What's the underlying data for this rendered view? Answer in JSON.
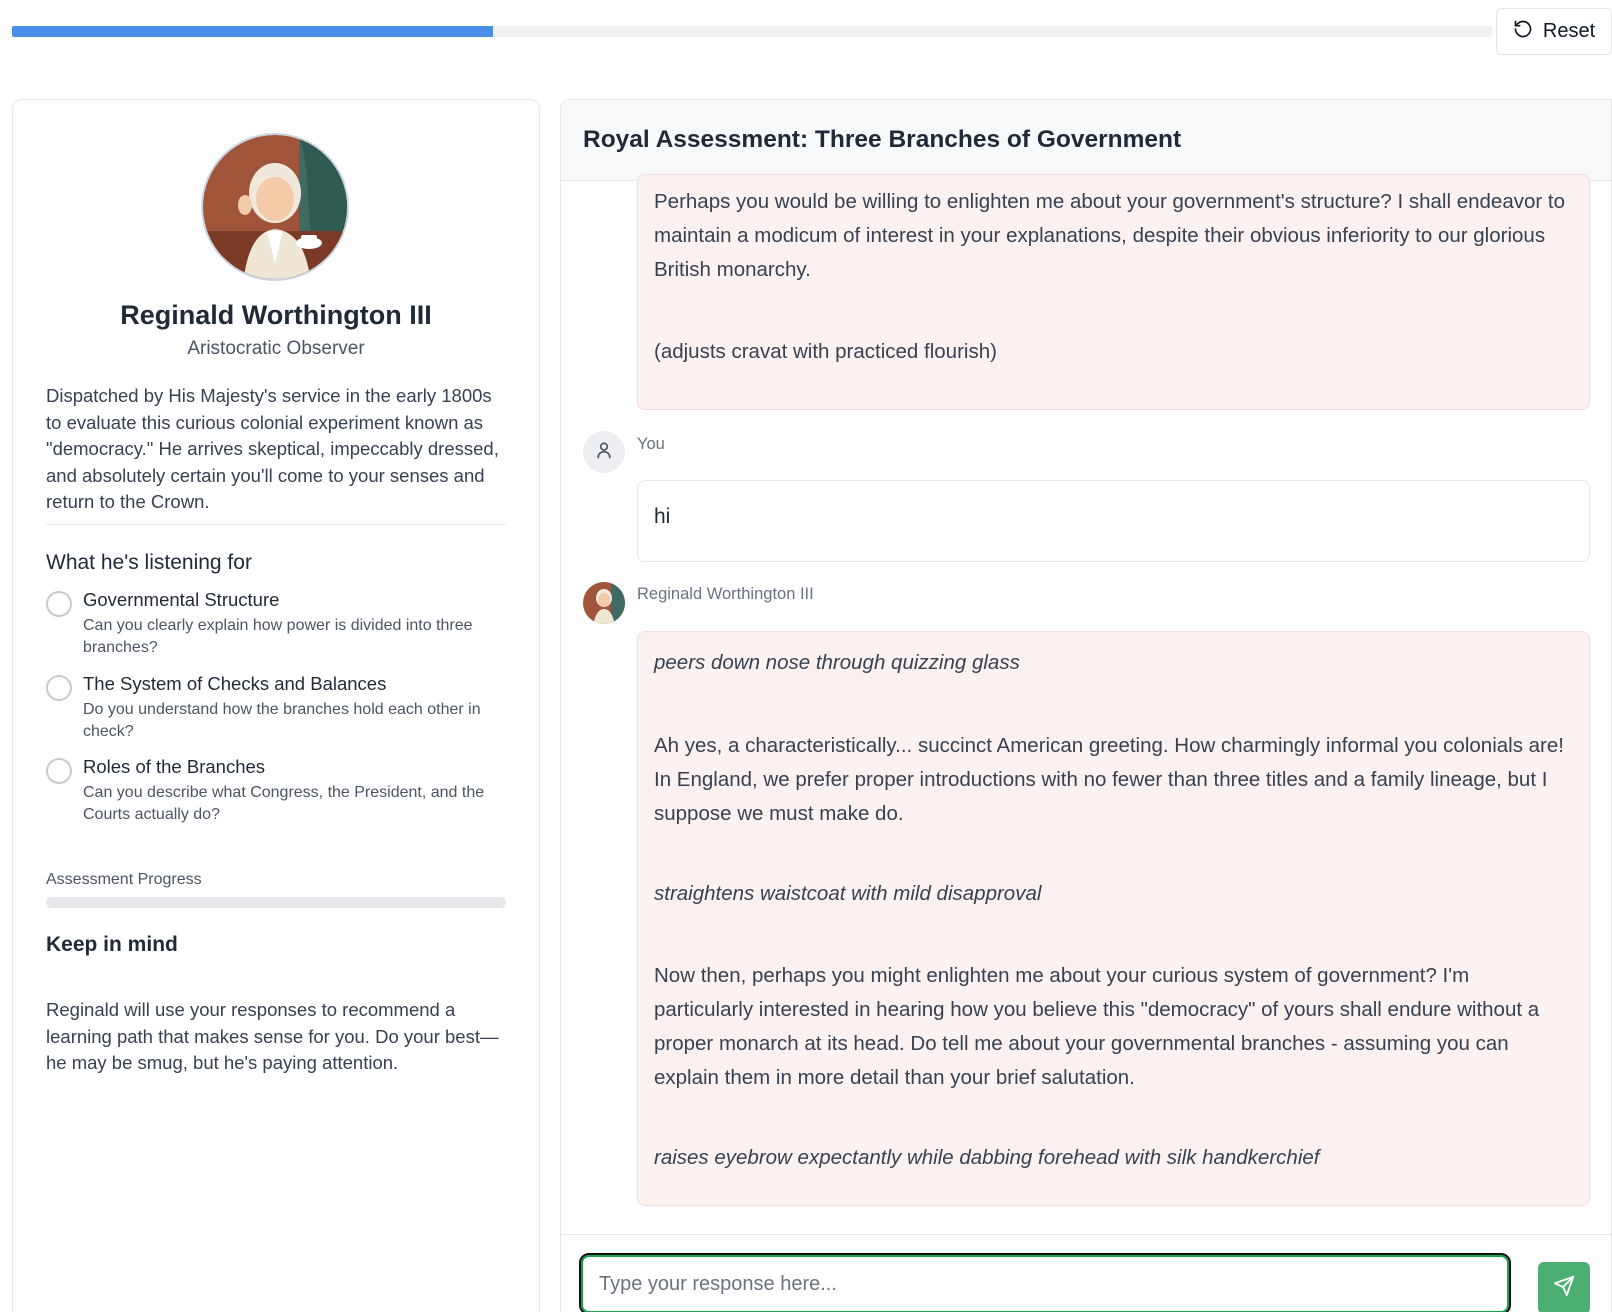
{
  "top": {
    "progress_fraction": 0.325,
    "reset_label": "Reset"
  },
  "character": {
    "name": "Reginald Worthington III",
    "role": "Aristocratic Observer",
    "description": "Dispatched by His Majesty's service in the early 1800s to evaluate this curious colonial experiment known as \"democracy.\" He arrives skeptical, impeccably dressed, and absolutely certain you'll come to your senses and return to the Crown."
  },
  "listening": {
    "title": "What he's listening for",
    "criteria": [
      {
        "title": "Governmental Structure",
        "desc": "Can you clearly explain how power is divided into three branches?",
        "checked": false
      },
      {
        "title": "The System of Checks and Balances",
        "desc": "Do you understand how the branches hold each other in check?",
        "checked": false
      },
      {
        "title": "Roles of the Branches",
        "desc": "Can you describe what Congress, the President, and the Courts actually do?",
        "checked": false
      }
    ]
  },
  "assessment": {
    "label": "Assessment Progress",
    "progress_fraction": 0
  },
  "keep_in_mind": {
    "title": "Keep in mind",
    "text": "Reginald will use your responses to recommend a learning path that makes sense for you. Do your best—he may be smug, but he's paying attention."
  },
  "chat": {
    "title": "Royal Assessment: Three Branches of Government",
    "messages": [
      {
        "sender": "Reginald Worthington III",
        "paragraphs": [
          "Perhaps you would be willing to enlighten me about your government's structure? I shall endeavor to maintain a modicum of interest in your explanations, despite their obvious inferiority to our glorious British monarchy.",
          "(adjusts cravat with practiced flourish)"
        ]
      },
      {
        "sender": "You",
        "paragraphs": [
          "hi"
        ]
      },
      {
        "sender": "Reginald Worthington III",
        "paragraphs": [
          "peers down nose through quizzing glass",
          "Ah yes, a characteristically... succinct American greeting. How charmingly informal you colonials are! In England, we prefer proper introductions with no fewer than three titles and a family lineage, but I suppose we must make do.",
          "straightens waistcoat with mild disapproval",
          "Now then, perhaps you might enlighten me about your curious system of government? I'm particularly interested in hearing how you believe this \"democracy\" of yours shall endure without a proper monarch at its head. Do tell me about your governmental branches - assuming you can explain them in more detail than your brief salutation.",
          "raises eyebrow expectantly while dabbing forehead with silk handkerchief"
        ]
      }
    ],
    "input_placeholder": "Type your response here...",
    "input_value": ""
  },
  "colors": {
    "accent_blue": "#4a8fe7",
    "send_green": "#4caf72",
    "ai_bubble_bg": "#fcf1f1"
  },
  "icons": {
    "reset": "rotate-ccw-icon",
    "user_avatar": "user-icon",
    "send": "send-icon"
  }
}
